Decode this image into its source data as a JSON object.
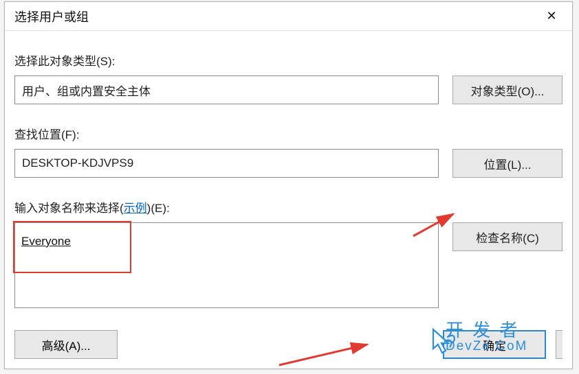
{
  "dialog": {
    "title": "选择用户或组",
    "object_type": {
      "label": "选择此对象类型(S):",
      "value": "用户、组或内置安全主体",
      "button": "对象类型(O)..."
    },
    "location": {
      "label": "查找位置(F):",
      "value": "DESKTOP-KDJVPS9",
      "button": "位置(L)..."
    },
    "names": {
      "label_prefix": "输入对象名称来选择(",
      "example_link": "示例",
      "label_suffix": ")(E):",
      "value": "Everyone",
      "check_button": "检查名称(C)"
    },
    "footer": {
      "advanced": "高级(A)...",
      "ok": "确定"
    }
  },
  "overlay": {
    "line1": "开 发 者",
    "line2": "DevZe.CoM"
  }
}
